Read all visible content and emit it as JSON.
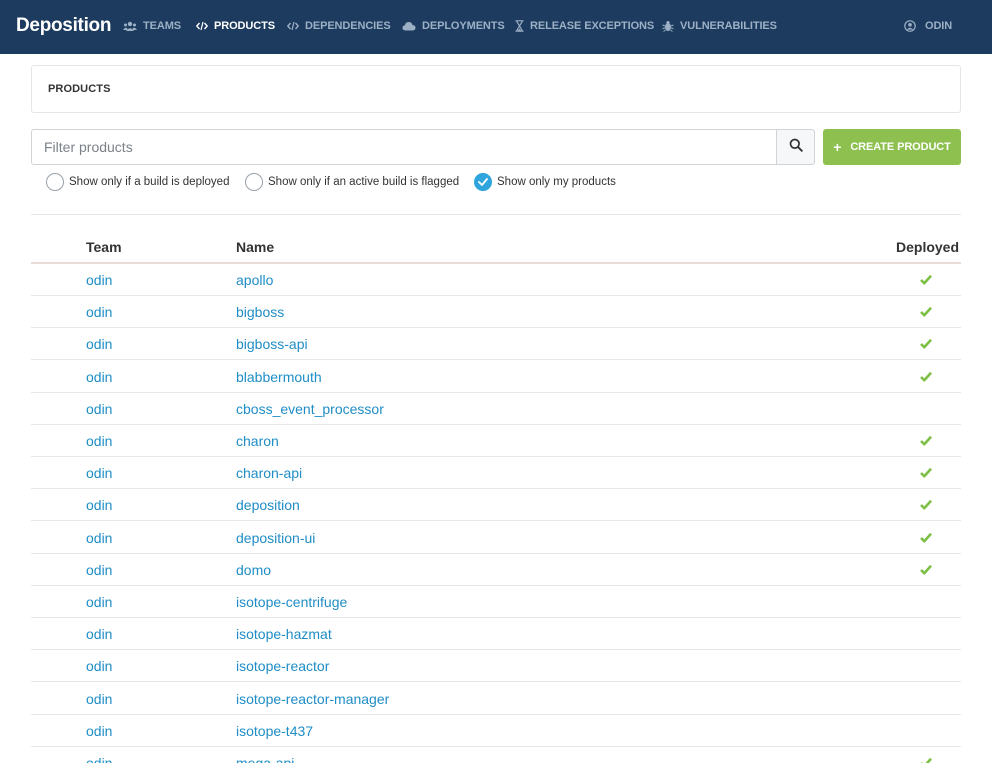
{
  "app": {
    "brand": "Deposition"
  },
  "nav": {
    "teams": "TEAMS",
    "products": "PRODUCTS",
    "dependencies": "DEPENDENCIES",
    "deployments": "DEPLOYMENTS",
    "release_exceptions": "RELEASE EXCEPTIONS",
    "vulnerabilities": "VULNERABILITIES",
    "user": "ODIN"
  },
  "panel": {
    "title": "PRODUCTS"
  },
  "filter": {
    "placeholder": "Filter products",
    "value": ""
  },
  "create_button": {
    "label": "CREATE PRODUCT"
  },
  "options": [
    {
      "label": "Show only if a build is deployed",
      "checked": false
    },
    {
      "label": "Show only if an active build is flagged",
      "checked": false
    },
    {
      "label": "Show only my products",
      "checked": true
    }
  ],
  "table": {
    "headers": {
      "team": "Team",
      "name": "Name",
      "deployed": "Deployed"
    },
    "rows": [
      {
        "team": "odin",
        "name": "apollo",
        "deployed": true
      },
      {
        "team": "odin",
        "name": "bigboss",
        "deployed": true
      },
      {
        "team": "odin",
        "name": "bigboss-api",
        "deployed": true
      },
      {
        "team": "odin",
        "name": "blabbermouth",
        "deployed": true
      },
      {
        "team": "odin",
        "name": "cboss_event_processor",
        "deployed": false
      },
      {
        "team": "odin",
        "name": "charon",
        "deployed": true
      },
      {
        "team": "odin",
        "name": "charon-api",
        "deployed": true
      },
      {
        "team": "odin",
        "name": "deposition",
        "deployed": true
      },
      {
        "team": "odin",
        "name": "deposition-ui",
        "deployed": true
      },
      {
        "team": "odin",
        "name": "domo",
        "deployed": true
      },
      {
        "team": "odin",
        "name": "isotope-centrifuge",
        "deployed": false
      },
      {
        "team": "odin",
        "name": "isotope-hazmat",
        "deployed": false
      },
      {
        "team": "odin",
        "name": "isotope-reactor",
        "deployed": false
      },
      {
        "team": "odin",
        "name": "isotope-reactor-manager",
        "deployed": false
      },
      {
        "team": "odin",
        "name": "isotope-t437",
        "deployed": false
      },
      {
        "team": "odin",
        "name": "mega-api",
        "deployed": true
      }
    ]
  },
  "colors": {
    "navbar": "#1c3b5e",
    "link": "#1f8dc6",
    "success": "#8dc04f",
    "check": "#7cc043",
    "radio_checked": "#2ea5dc"
  }
}
